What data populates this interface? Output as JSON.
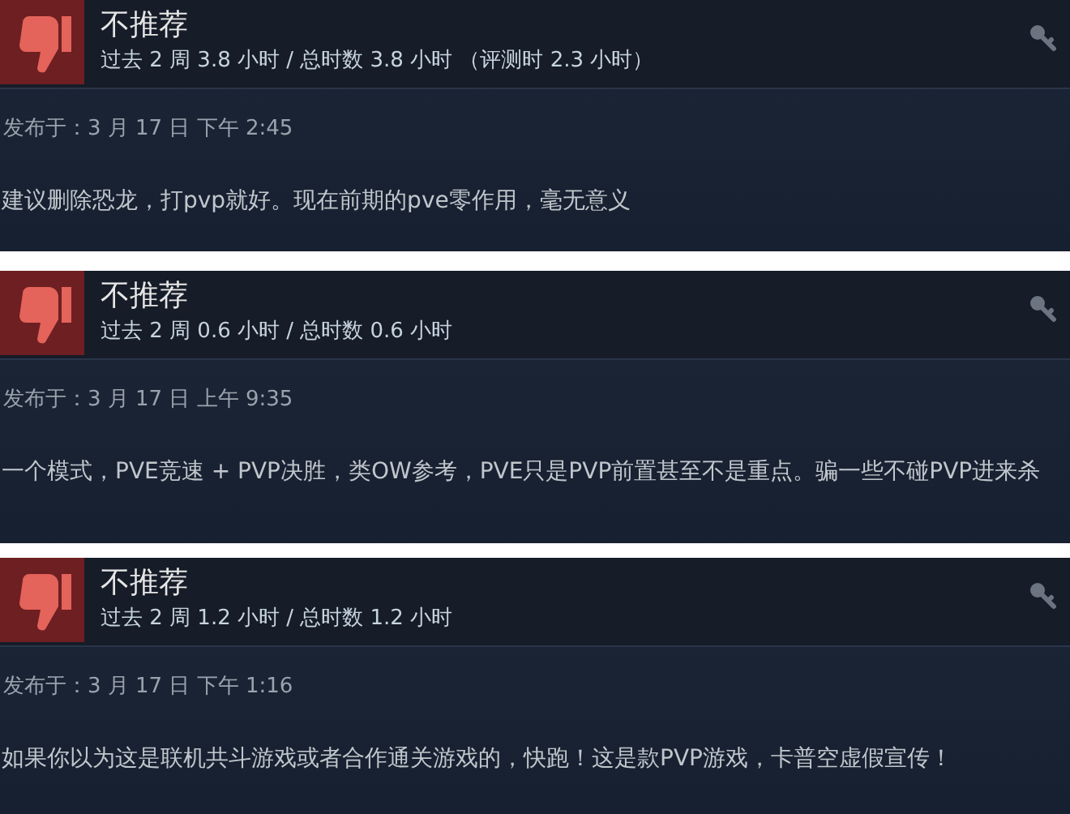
{
  "reviews": [
    {
      "recommended": false,
      "verdict": "不推荐",
      "hours": "过去 2 周 3.8 小时 / 总时数 3.8 小时 （评测时 2.3 小时）",
      "posted": "发布于：3 月 17 日 下午 2:45",
      "body": "建议删除恐龙，打pvp就好。现在前期的pve零作用，毫无意义"
    },
    {
      "recommended": false,
      "verdict": "不推荐",
      "hours": "过去 2 周 0.6 小时 / 总时数 0.6 小时",
      "posted": "发布于：3 月 17 日 上午 9:35",
      "body": "一个模式，PVE竞速 + PVP决胜，类OW参考，PVE只是PVP前置甚至不是重点。骗一些不碰PVP进来杀"
    },
    {
      "recommended": false,
      "verdict": "不推荐",
      "hours": "过去 2 周 1.2 小时 / 总时数 1.2 小时",
      "posted": "发布于：3 月 17 日 下午 1:16",
      "body": "如果你以为这是联机共斗游戏或者合作通关游戏的，快跑！这是款PVP游戏，卡普空虚假宣传！"
    }
  ]
}
